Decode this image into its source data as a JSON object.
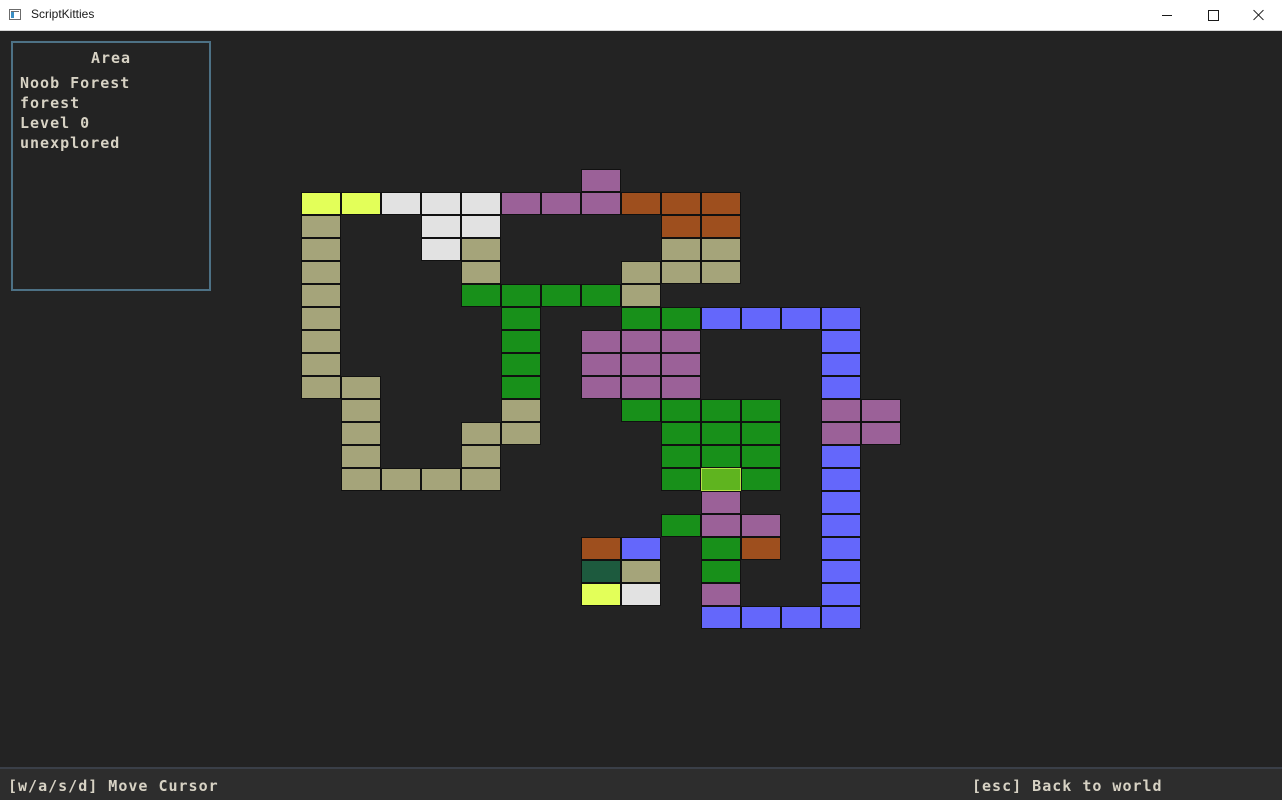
{
  "window": {
    "title": "ScriptKitties",
    "icon": "app-window-icon",
    "controls": [
      "minimize-icon",
      "maximize-icon",
      "close-icon"
    ]
  },
  "area_panel": {
    "heading": "Area",
    "name": "Noob Forest",
    "type": "forest",
    "level": "Level 0",
    "status": "unexplored"
  },
  "footer": {
    "move_hint": "[w/a/s/d] Move Cursor",
    "back_hint": "[esc] Back to world"
  },
  "colors": {
    "background": "#232323",
    "panel_border": "#4d7185",
    "text": "#d7d2c4",
    "tile_border": "#111111",
    "selected_tile": "#5fb41f"
  },
  "legend_colors": {
    "yellow": "#e3ff59",
    "white": "#e2e2e2",
    "purple": "#9b6198",
    "brown": "#9e4f1e",
    "khaki": "#a5a47a",
    "green": "#18901a",
    "blue": "#6467fb",
    "darkgreen": "#1d5a3e",
    "lime": "#5fb41f"
  },
  "map": {
    "cursor": [
      10,
      13
    ],
    "tiles": [
      {
        "c": 7,
        "r": 0,
        "t": "purple"
      },
      {
        "c": 0,
        "r": 1,
        "t": "yellow"
      },
      {
        "c": 1,
        "r": 1,
        "t": "yellow"
      },
      {
        "c": 2,
        "r": 1,
        "t": "white"
      },
      {
        "c": 3,
        "r": 1,
        "t": "white"
      },
      {
        "c": 4,
        "r": 1,
        "t": "white"
      },
      {
        "c": 5,
        "r": 1,
        "t": "purple"
      },
      {
        "c": 6,
        "r": 1,
        "t": "purple"
      },
      {
        "c": 7,
        "r": 1,
        "t": "purple"
      },
      {
        "c": 8,
        "r": 1,
        "t": "brown"
      },
      {
        "c": 9,
        "r": 1,
        "t": "brown"
      },
      {
        "c": 10,
        "r": 1,
        "t": "brown"
      },
      {
        "c": 0,
        "r": 2,
        "t": "khaki"
      },
      {
        "c": 3,
        "r": 2,
        "t": "white"
      },
      {
        "c": 4,
        "r": 2,
        "t": "white"
      },
      {
        "c": 9,
        "r": 2,
        "t": "brown"
      },
      {
        "c": 10,
        "r": 2,
        "t": "brown"
      },
      {
        "c": 0,
        "r": 3,
        "t": "khaki"
      },
      {
        "c": 3,
        "r": 3,
        "t": "white"
      },
      {
        "c": 4,
        "r": 3,
        "t": "khaki"
      },
      {
        "c": 9,
        "r": 3,
        "t": "khaki"
      },
      {
        "c": 10,
        "r": 3,
        "t": "khaki"
      },
      {
        "c": 0,
        "r": 4,
        "t": "khaki"
      },
      {
        "c": 4,
        "r": 4,
        "t": "khaki"
      },
      {
        "c": 8,
        "r": 4,
        "t": "khaki"
      },
      {
        "c": 9,
        "r": 4,
        "t": "khaki"
      },
      {
        "c": 10,
        "r": 4,
        "t": "khaki"
      },
      {
        "c": 0,
        "r": 5,
        "t": "khaki"
      },
      {
        "c": 4,
        "r": 5,
        "t": "green"
      },
      {
        "c": 5,
        "r": 5,
        "t": "green"
      },
      {
        "c": 6,
        "r": 5,
        "t": "green"
      },
      {
        "c": 7,
        "r": 5,
        "t": "green"
      },
      {
        "c": 8,
        "r": 5,
        "t": "khaki"
      },
      {
        "c": 0,
        "r": 6,
        "t": "khaki"
      },
      {
        "c": 5,
        "r": 6,
        "t": "green"
      },
      {
        "c": 8,
        "r": 6,
        "t": "green"
      },
      {
        "c": 9,
        "r": 6,
        "t": "green"
      },
      {
        "c": 10,
        "r": 6,
        "t": "blue"
      },
      {
        "c": 11,
        "r": 6,
        "t": "blue"
      },
      {
        "c": 12,
        "r": 6,
        "t": "blue"
      },
      {
        "c": 13,
        "r": 6,
        "t": "blue"
      },
      {
        "c": 0,
        "r": 7,
        "t": "khaki"
      },
      {
        "c": 5,
        "r": 7,
        "t": "green"
      },
      {
        "c": 7,
        "r": 7,
        "t": "purple"
      },
      {
        "c": 8,
        "r": 7,
        "t": "purple"
      },
      {
        "c": 9,
        "r": 7,
        "t": "purple"
      },
      {
        "c": 13,
        "r": 7,
        "t": "blue"
      },
      {
        "c": 0,
        "r": 8,
        "t": "khaki"
      },
      {
        "c": 5,
        "r": 8,
        "t": "green"
      },
      {
        "c": 7,
        "r": 8,
        "t": "purple"
      },
      {
        "c": 8,
        "r": 8,
        "t": "purple"
      },
      {
        "c": 9,
        "r": 8,
        "t": "purple"
      },
      {
        "c": 13,
        "r": 8,
        "t": "blue"
      },
      {
        "c": 0,
        "r": 9,
        "t": "khaki"
      },
      {
        "c": 1,
        "r": 9,
        "t": "khaki"
      },
      {
        "c": 5,
        "r": 9,
        "t": "green"
      },
      {
        "c": 7,
        "r": 9,
        "t": "purple"
      },
      {
        "c": 8,
        "r": 9,
        "t": "purple"
      },
      {
        "c": 9,
        "r": 9,
        "t": "purple"
      },
      {
        "c": 13,
        "r": 9,
        "t": "blue"
      },
      {
        "c": 1,
        "r": 10,
        "t": "khaki"
      },
      {
        "c": 5,
        "r": 10,
        "t": "khaki"
      },
      {
        "c": 8,
        "r": 10,
        "t": "green"
      },
      {
        "c": 9,
        "r": 10,
        "t": "green"
      },
      {
        "c": 10,
        "r": 10,
        "t": "green"
      },
      {
        "c": 11,
        "r": 10,
        "t": "green"
      },
      {
        "c": 13,
        "r": 10,
        "t": "purple"
      },
      {
        "c": 14,
        "r": 10,
        "t": "purple"
      },
      {
        "c": 1,
        "r": 11,
        "t": "khaki"
      },
      {
        "c": 4,
        "r": 11,
        "t": "khaki"
      },
      {
        "c": 5,
        "r": 11,
        "t": "khaki"
      },
      {
        "c": 9,
        "r": 11,
        "t": "green"
      },
      {
        "c": 10,
        "r": 11,
        "t": "green"
      },
      {
        "c": 11,
        "r": 11,
        "t": "green"
      },
      {
        "c": 13,
        "r": 11,
        "t": "purple"
      },
      {
        "c": 14,
        "r": 11,
        "t": "purple"
      },
      {
        "c": 1,
        "r": 12,
        "t": "khaki"
      },
      {
        "c": 4,
        "r": 12,
        "t": "khaki"
      },
      {
        "c": 9,
        "r": 12,
        "t": "green"
      },
      {
        "c": 10,
        "r": 12,
        "t": "green"
      },
      {
        "c": 11,
        "r": 12,
        "t": "green"
      },
      {
        "c": 13,
        "r": 12,
        "t": "blue"
      },
      {
        "c": 1,
        "r": 13,
        "t": "khaki"
      },
      {
        "c": 2,
        "r": 13,
        "t": "khaki"
      },
      {
        "c": 3,
        "r": 13,
        "t": "khaki"
      },
      {
        "c": 4,
        "r": 13,
        "t": "khaki"
      },
      {
        "c": 9,
        "r": 13,
        "t": "green"
      },
      {
        "c": 10,
        "r": 13,
        "t": "lime"
      },
      {
        "c": 11,
        "r": 13,
        "t": "green"
      },
      {
        "c": 13,
        "r": 13,
        "t": "blue"
      },
      {
        "c": 10,
        "r": 14,
        "t": "purple"
      },
      {
        "c": 13,
        "r": 14,
        "t": "blue"
      },
      {
        "c": 9,
        "r": 15,
        "t": "green"
      },
      {
        "c": 10,
        "r": 15,
        "t": "purple"
      },
      {
        "c": 11,
        "r": 15,
        "t": "purple"
      },
      {
        "c": 13,
        "r": 15,
        "t": "blue"
      },
      {
        "c": 7,
        "r": 16,
        "t": "brown"
      },
      {
        "c": 8,
        "r": 16,
        "t": "blue"
      },
      {
        "c": 10,
        "r": 16,
        "t": "green"
      },
      {
        "c": 11,
        "r": 16,
        "t": "brown"
      },
      {
        "c": 13,
        "r": 16,
        "t": "blue"
      },
      {
        "c": 7,
        "r": 17,
        "t": "darkgreen"
      },
      {
        "c": 8,
        "r": 17,
        "t": "khaki"
      },
      {
        "c": 10,
        "r": 17,
        "t": "green"
      },
      {
        "c": 13,
        "r": 17,
        "t": "blue"
      },
      {
        "c": 7,
        "r": 18,
        "t": "yellow"
      },
      {
        "c": 8,
        "r": 18,
        "t": "white"
      },
      {
        "c": 10,
        "r": 18,
        "t": "purple"
      },
      {
        "c": 13,
        "r": 18,
        "t": "blue"
      },
      {
        "c": 10,
        "r": 19,
        "t": "blue"
      },
      {
        "c": 11,
        "r": 19,
        "t": "blue"
      },
      {
        "c": 12,
        "r": 19,
        "t": "blue"
      },
      {
        "c": 13,
        "r": 19,
        "t": "blue"
      }
    ]
  }
}
